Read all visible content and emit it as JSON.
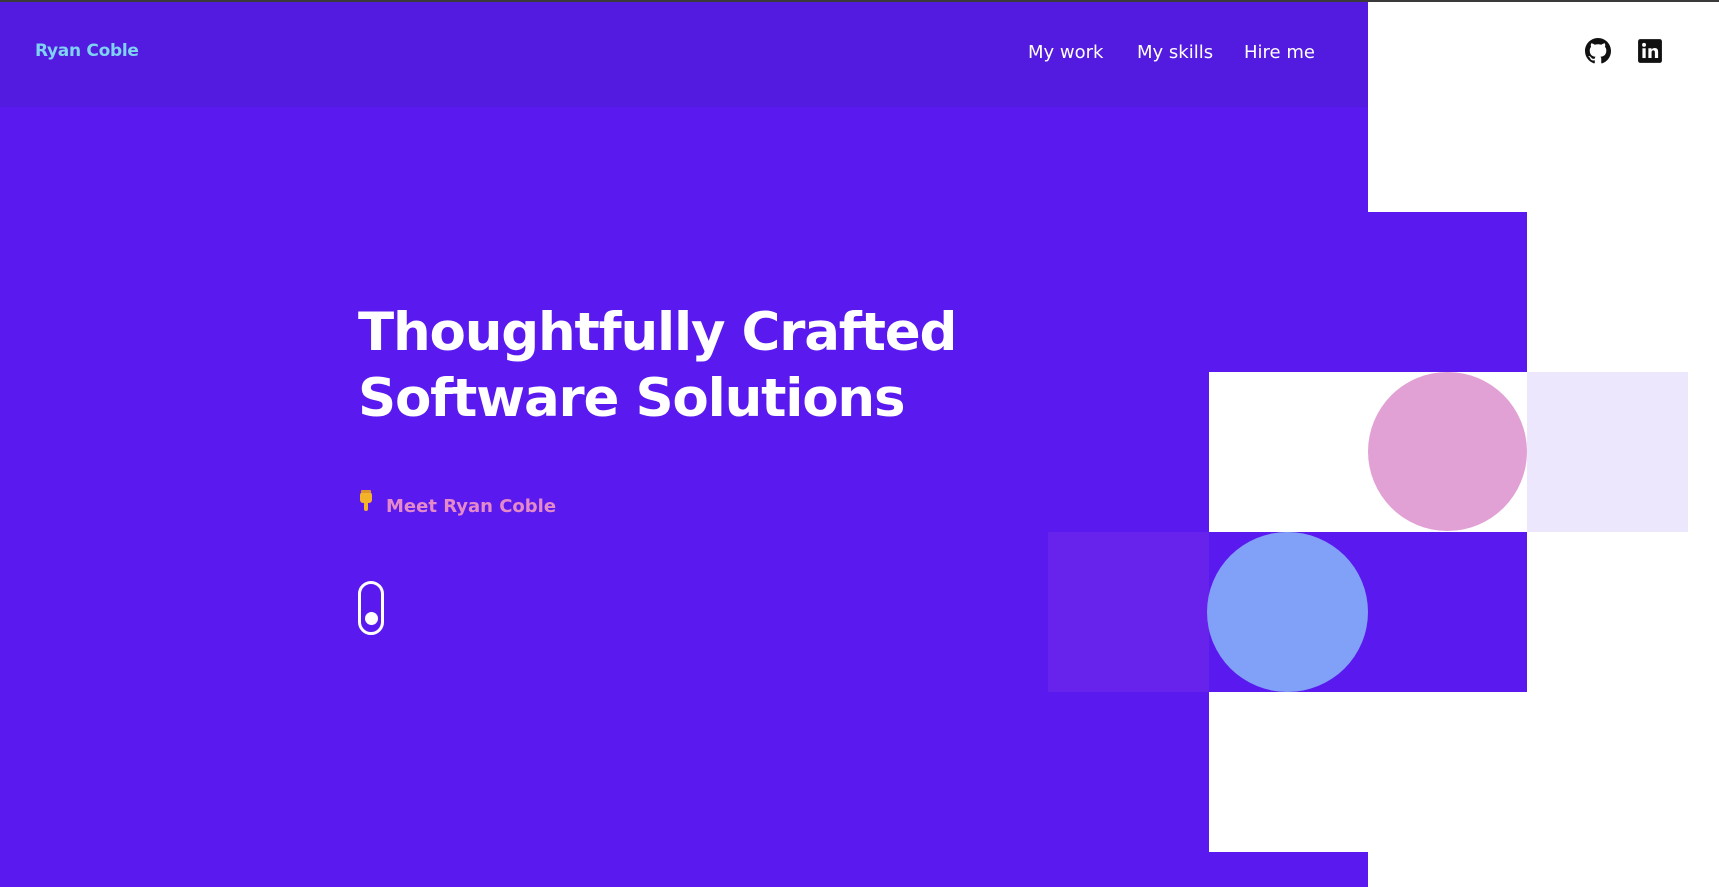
{
  "brand": {
    "name": "Ryan Coble"
  },
  "nav": {
    "items": [
      {
        "label": "My work"
      },
      {
        "label": "My skills"
      },
      {
        "label": "Hire me"
      }
    ]
  },
  "social": {
    "icons": [
      "github-icon",
      "linkedin-icon"
    ]
  },
  "hero": {
    "title_line1": "Thoughtfully Crafted",
    "title_line2": "Software Solutions",
    "meet_icon": "pointing-down-hand-icon",
    "meet_label": "Meet Ryan Coble"
  },
  "colors": {
    "purple": "#5a19ef",
    "header": "#531ae0",
    "brand": "#7fd3f2",
    "meet": "#e58ac9",
    "pink_circle": "#e2a1d5",
    "blue_circle": "#81a1f8",
    "lavender": "#ece7fc"
  }
}
